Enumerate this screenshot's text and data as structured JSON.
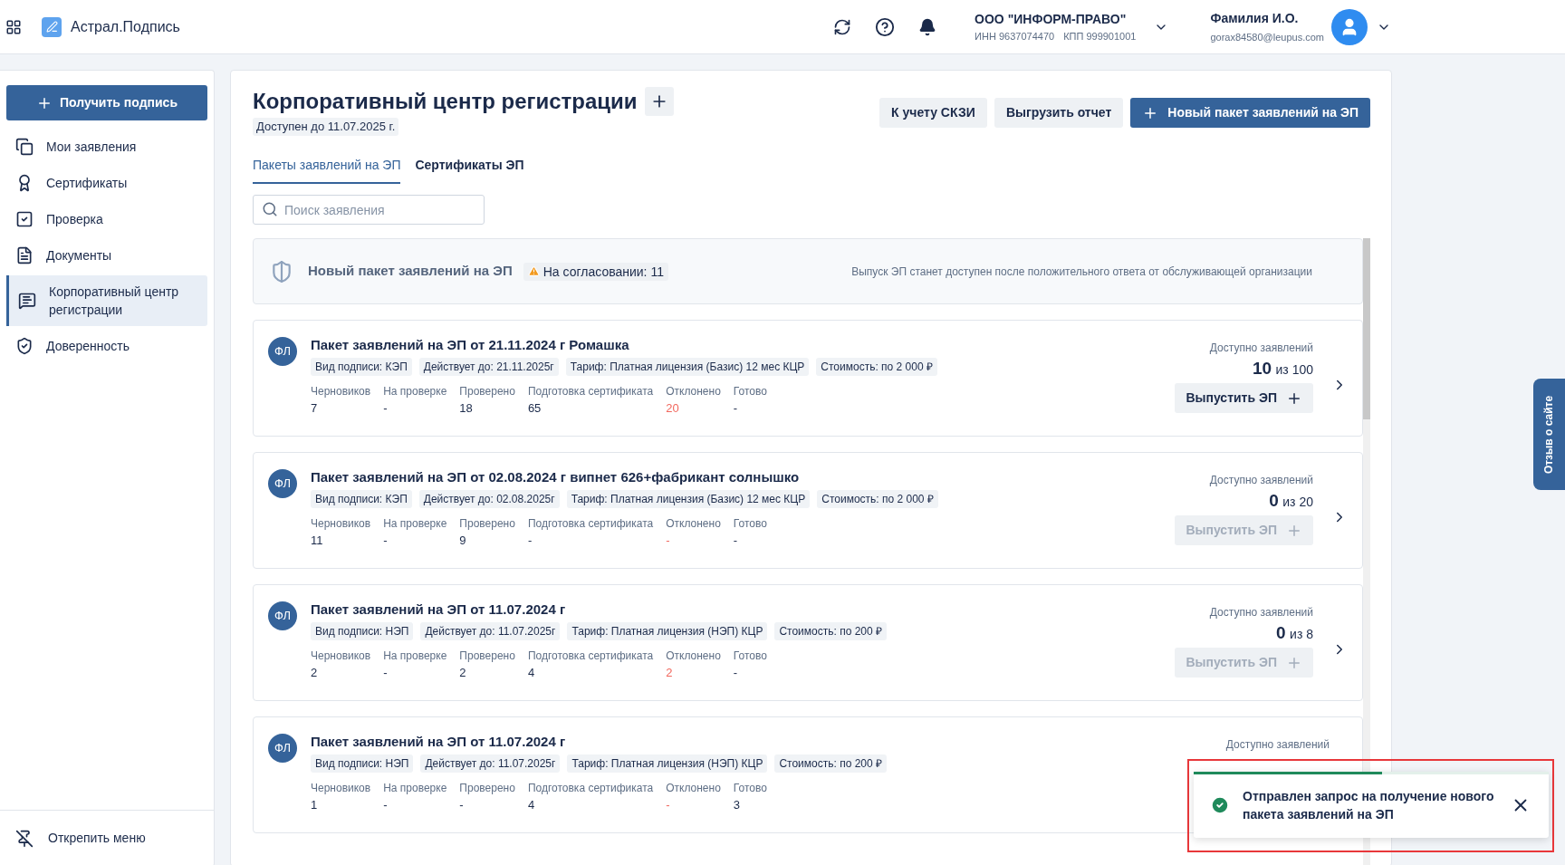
{
  "header": {
    "app_name": "Астрал.Подпись",
    "org": {
      "name": "ООО \"ИНФОРМ-ПРАВО\"",
      "inn": "ИНН 9637074470",
      "kpp": "КПП 999901001"
    },
    "user": {
      "name": "Фамилия И.О.",
      "email": "gorax84580@leupus.com"
    }
  },
  "sidebar": {
    "action": "Получить подпись",
    "items": [
      {
        "label": "Мои заявления",
        "selected": false
      },
      {
        "label": "Сертификаты",
        "selected": false
      },
      {
        "label": "Проверка",
        "selected": false
      },
      {
        "label": "Документы",
        "selected": false
      },
      {
        "label": "Корпоративный центр регистрации",
        "selected": true
      },
      {
        "label": "Доверенность",
        "selected": false
      }
    ],
    "unpin": "Открепить меню"
  },
  "page": {
    "title": "Корпоративный центр регистрации",
    "available_until": "Доступен до 11.07.2025 г.",
    "buttons": [
      {
        "label": "К учету СКЗИ",
        "kind": "secondary"
      },
      {
        "label": "Выгрузить отчет",
        "kind": "secondary"
      },
      {
        "label": "Новый пакет заявлений на ЭП",
        "kind": "primary"
      }
    ],
    "tabs": [
      {
        "label": "Пакеты заявлений на ЭП",
        "selected": true
      },
      {
        "label": "Сертификаты ЭП",
        "selected": false
      }
    ],
    "search": {
      "placeholder": "Поиск заявления"
    },
    "pending": {
      "title": "Новый пакет заявлений на ЭП",
      "badge": "На согласовании: 11",
      "note": "Выпуск ЭП станет доступен после положительного ответа от обслуживающей организации"
    },
    "packages": [
      {
        "avatar": "ФЛ",
        "title": "Пакет заявлений на ЭП от 21.11.2024 г Ромашка",
        "tags": [
          "Вид подписи: КЭП",
          "Действует до: 21.11.2025г",
          "Тариф: Платная лицензия (Базис) 12 мес КЦР",
          "Стоимость: по 2 000 ₽"
        ],
        "stats": [
          {
            "label": "Черновиков",
            "value": "7",
            "highlighted": false
          },
          {
            "label": "На проверке",
            "value": "-",
            "highlighted": false
          },
          {
            "label": "Проверено",
            "value": "18",
            "highlighted": false
          },
          {
            "label": "Подготовка сертификата",
            "value": "65",
            "highlighted": false
          },
          {
            "label": "Отклонено",
            "value": "20",
            "highlighted": true
          },
          {
            "label": "Готово",
            "value": "-",
            "highlighted": false
          }
        ],
        "available_label": "Доступно заявлений",
        "available": "10",
        "of": "из 100",
        "issue_button": {
          "label": "Выпустить ЭП",
          "disabled": false
        }
      },
      {
        "avatar": "ФЛ",
        "title": "Пакет заявлений на ЭП от 02.08.2024 г випнет 626+фабрикант солнышко",
        "tags": [
          "Вид подписи: КЭП",
          "Действует до: 02.08.2025г",
          "Тариф: Платная лицензия (Базис) 12 мес КЦР",
          "Стоимость: по 2 000 ₽"
        ],
        "stats": [
          {
            "label": "Черновиков",
            "value": "11",
            "highlighted": false
          },
          {
            "label": "На проверке",
            "value": "-",
            "highlighted": false
          },
          {
            "label": "Проверено",
            "value": "9",
            "highlighted": false
          },
          {
            "label": "Подготовка сертификата",
            "value": "-",
            "highlighted": false
          },
          {
            "label": "Отклонено",
            "value": "-",
            "highlighted": true
          },
          {
            "label": "Готово",
            "value": "-",
            "highlighted": false
          }
        ],
        "available_label": "Доступно заявлений",
        "available": "0",
        "of": "из 20",
        "issue_button": {
          "label": "Выпустить ЭП",
          "disabled": true
        }
      },
      {
        "avatar": "ФЛ",
        "title": "Пакет заявлений на ЭП от 11.07.2024 г",
        "tags": [
          "Вид подписи: НЭП",
          "Действует до: 11.07.2025г",
          "Тариф: Платная лицензия (НЭП) КЦР",
          "Стоимость: по 200 ₽"
        ],
        "stats": [
          {
            "label": "Черновиков",
            "value": "2",
            "highlighted": false
          },
          {
            "label": "На проверке",
            "value": "-",
            "highlighted": false
          },
          {
            "label": "Проверено",
            "value": "2",
            "highlighted": false
          },
          {
            "label": "Подготовка сертификата",
            "value": "4",
            "highlighted": false
          },
          {
            "label": "Отклонено",
            "value": "2",
            "highlighted": true
          },
          {
            "label": "Готово",
            "value": "-",
            "highlighted": false
          }
        ],
        "available_label": "Доступно заявлений",
        "available": "0",
        "of": "из 8",
        "issue_button": {
          "label": "Выпустить ЭП",
          "disabled": true
        }
      },
      {
        "avatar": "ФЛ",
        "title": "Пакет заявлений на ЭП от 11.07.2024 г",
        "tags": [
          "Вид подписи: НЭП",
          "Действует до: 11.07.2025г",
          "Тариф: Платная лицензия (НЭП) КЦР",
          "Стоимость: по 200 ₽"
        ],
        "stats": [
          {
            "label": "Черновиков",
            "value": "1",
            "highlighted": false
          },
          {
            "label": "На проверке",
            "value": "-",
            "highlighted": false
          },
          {
            "label": "Проверено",
            "value": "-",
            "highlighted": false
          },
          {
            "label": "Подготовка сертификата",
            "value": "4",
            "highlighted": false
          },
          {
            "label": "Отклонено",
            "value": "-",
            "highlighted": true
          },
          {
            "label": "Готово",
            "value": "3",
            "highlighted": false
          }
        ],
        "available_label": "Доступно заявлений"
      }
    ]
  },
  "feedback_tab": "Отзыв о сайте",
  "toast": {
    "message": "Отправлен запрос на получение нового пакета заявлений на ЭП",
    "level": 0.53
  }
}
